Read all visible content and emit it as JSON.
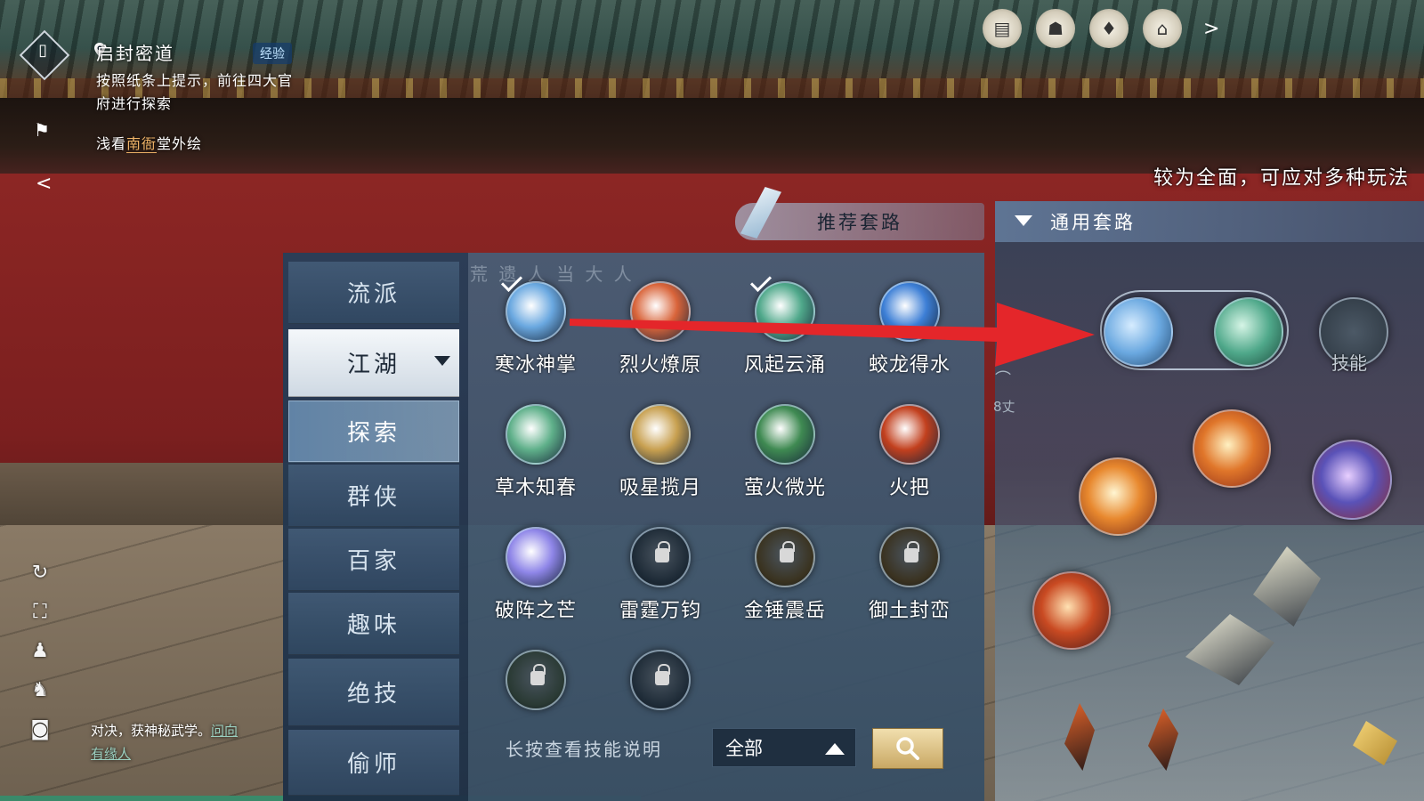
{
  "quest": {
    "badge_icon": "scroll-icon",
    "title": "启封密道",
    "tag": "经验",
    "description": "按照纸条上提示，前往四大官府进行探索",
    "sub_prefix": "浅看",
    "sub_highlight": "南衙",
    "sub_suffix": "堂外绘",
    "collapse_symbol": "<"
  },
  "top_icons": [
    "book-icon",
    "mask-icon",
    "cards-icon",
    "guild-icon"
  ],
  "top_more_symbol": ">",
  "left_icons": [
    "refresh-icon",
    "fullscreen-icon",
    "character-icon",
    "pose-icon",
    "camera-icon"
  ],
  "npc_text": {
    "main": "对决，获神秘武学。",
    "link_a": "问向",
    "link_b": "有缘人"
  },
  "description_line": "较为全面，可应对多种玩法",
  "tabs": {
    "recommended": "推荐套路",
    "general": "通用套路"
  },
  "categories": [
    {
      "label": "流派"
    },
    {
      "label": "江湖"
    },
    {
      "label": "探索"
    },
    {
      "label": "群侠"
    },
    {
      "label": "百家"
    },
    {
      "label": "趣味"
    },
    {
      "label": "绝技"
    },
    {
      "label": "偷师"
    }
  ],
  "grid_header": "荒   遗  人 当 大 人",
  "skills": [
    {
      "name": "寒冰神掌",
      "checked": true,
      "locked": false,
      "color": "#6aa8e0"
    },
    {
      "name": "烈火燎原",
      "checked": false,
      "locked": false,
      "color": "#d9643a"
    },
    {
      "name": "风起云涌",
      "checked": true,
      "locked": false,
      "color": "#4fa88a"
    },
    {
      "name": "蛟龙得水",
      "checked": false,
      "locked": false,
      "color": "#3d7fd6"
    },
    {
      "name": "草木知春",
      "checked": false,
      "locked": false,
      "color": "#5fb08a"
    },
    {
      "name": "吸星揽月",
      "checked": false,
      "locked": false,
      "color": "#c8a050"
    },
    {
      "name": "萤火微光",
      "checked": false,
      "locked": false,
      "color": "#3f8a52"
    },
    {
      "name": "火把",
      "checked": false,
      "locked": false,
      "color": "#c2401e"
    },
    {
      "name": "破阵之芒",
      "checked": false,
      "locked": false,
      "color": "#8f86e8"
    },
    {
      "name": "雷霆万钧",
      "checked": false,
      "locked": true,
      "color": "#1d2a36"
    },
    {
      "name": "金锤震岳",
      "checked": false,
      "locked": true,
      "color": "#3a3320"
    },
    {
      "name": "御土封峦",
      "checked": false,
      "locked": true,
      "color": "#3a3220"
    },
    {
      "name": "",
      "checked": false,
      "locked": true,
      "color": "#2a3a34"
    },
    {
      "name": "",
      "checked": false,
      "locked": true,
      "color": "#1f2c38"
    }
  ],
  "hint": "长按查看技能说明",
  "filter": {
    "value": "全部"
  },
  "search_icon": "search-icon",
  "loadout": {
    "slot_label": "技能",
    "distance": "8丈",
    "colors": {
      "ice": "#6aa8e0",
      "wind": "#4fa88a",
      "fire": "#e0762a",
      "blade": "#d8c690"
    }
  }
}
